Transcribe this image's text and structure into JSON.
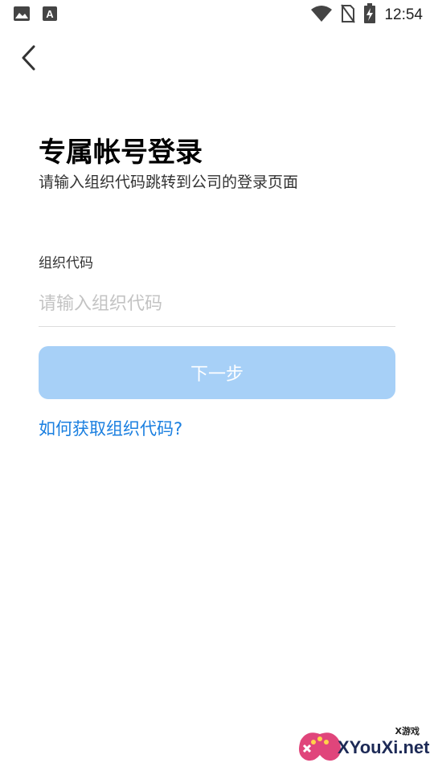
{
  "status_bar": {
    "time": "12:54",
    "icons": [
      "image-notification-icon",
      "font-notification-icon",
      "wifi-icon",
      "no-sim-icon",
      "battery-charging-icon"
    ]
  },
  "nav": {
    "back_icon": "chevron-left-icon"
  },
  "header": {
    "title": "专属帐号登录",
    "subtitle": "请输入组织代码跳转到公司的登录页面"
  },
  "form": {
    "org_code_label": "组织代码",
    "org_code_value": "",
    "org_code_placeholder": "请输入组织代码",
    "next_button_label": "下一步",
    "next_button_color": "#a7d0f7",
    "help_link": "如何获取组织代码?",
    "help_link_color": "#1a7fe0"
  },
  "watermark": {
    "small_text": "X游戏",
    "brand_text": "XYouXi.net"
  }
}
